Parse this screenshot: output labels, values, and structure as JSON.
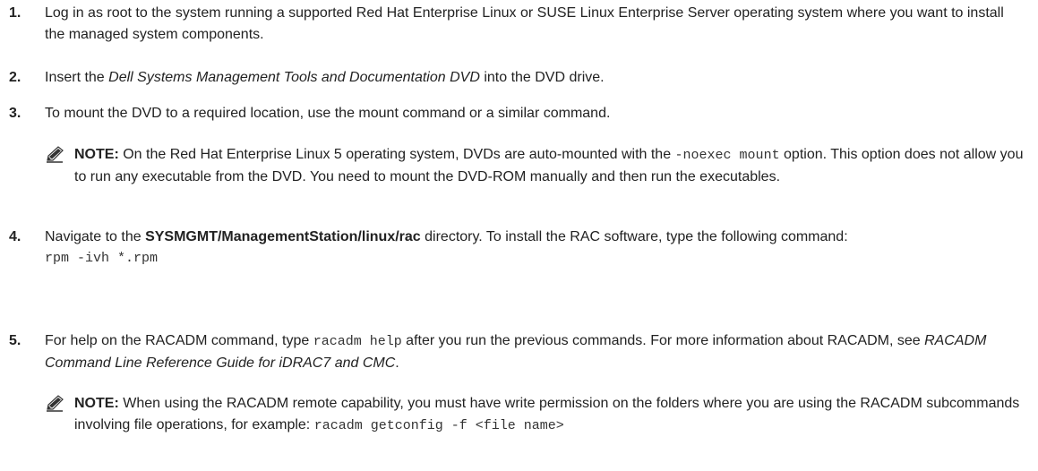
{
  "steps": [
    {
      "number": "1.",
      "text": "Log in as root to the system running a supported Red Hat Enterprise Linux or SUSE Linux Enterprise Server operating system where you want to install the managed system components."
    },
    {
      "number": "2.",
      "pre": "Insert the ",
      "italic": "Dell Systems Management Tools and Documentation DVD",
      "post": " into the DVD drive."
    },
    {
      "number": "3.",
      "text": "To mount the DVD to a required location, use the mount command or a similar command."
    },
    {
      "number": "4.",
      "pre": "Navigate to the ",
      "bold": "SYSMGMT/ManagementStation/linux/rac",
      "post": " directory. To install the RAC software, type the following command:",
      "command": "rpm -ivh *.rpm"
    },
    {
      "number": "5.",
      "pre": "For help on the RACADM command, type ",
      "code": "racadm help",
      "mid": " after you run the previous commands. For more information about RACADM, see ",
      "italic": "RACADM Command Line Reference Guide for iDRAC7 and CMC",
      "post": "."
    }
  ],
  "notes": [
    {
      "label": "NOTE:",
      "pre": " On the Red Hat Enterprise Linux 5 operating system, DVDs are auto-mounted with the ",
      "code": "-noexec mount",
      "post": " option. This option does not allow you to run any executable from the DVD. You need to mount the DVD-ROM manually and then run the executables."
    },
    {
      "label": "NOTE:",
      "pre": " When using the RACADM remote capability, you must have write permission on the folders where you are using the RACADM subcommands involving file operations, for example: ",
      "code": "racadm getconfig -f <file name>"
    }
  ],
  "icons": {
    "note": "pencil-note-icon"
  }
}
